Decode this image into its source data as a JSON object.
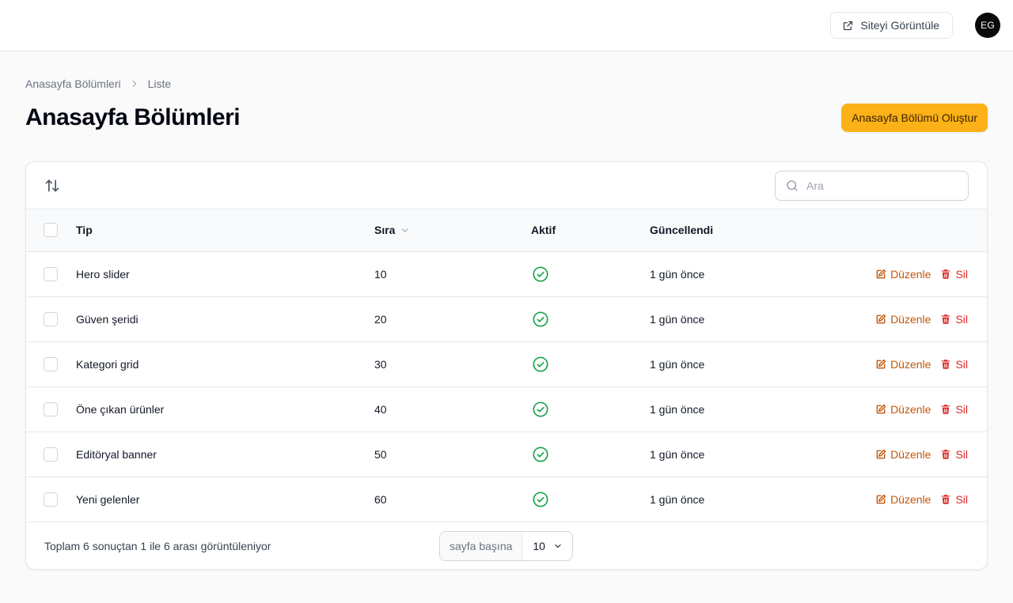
{
  "header": {
    "view_site_label": "Siteyi Görüntüle",
    "avatar_initials": "EG"
  },
  "breadcrumb": [
    "Anasayfa Bölümleri",
    "Liste"
  ],
  "page": {
    "title": "Anasayfa Bölümleri",
    "create_label": "Anasayfa Bölümü Oluştur"
  },
  "search": {
    "placeholder": "Ara"
  },
  "table": {
    "columns": {
      "tip": "Tip",
      "sira": "Sıra",
      "aktif": "Aktif",
      "guncellendi": "Güncellendi"
    },
    "rows": [
      {
        "tip": "Hero slider",
        "sira": "10",
        "aktif": true,
        "guncellendi": "1 gün önce"
      },
      {
        "tip": "Güven şeridi",
        "sira": "20",
        "aktif": true,
        "guncellendi": "1 gün önce"
      },
      {
        "tip": "Kategori grid",
        "sira": "30",
        "aktif": true,
        "guncellendi": "1 gün önce"
      },
      {
        "tip": "Öne çıkan ürünler",
        "sira": "40",
        "aktif": true,
        "guncellendi": "1 gün önce"
      },
      {
        "tip": "Editöryal banner",
        "sira": "50",
        "aktif": true,
        "guncellendi": "1 gün önce"
      },
      {
        "tip": "Yeni gelenler",
        "sira": "60",
        "aktif": true,
        "guncellendi": "1 gün önce"
      }
    ],
    "edit_label": "Düzenle",
    "delete_label": "Sil"
  },
  "footer": {
    "summary": "Toplam 6 sonuçtan 1 ile 6 arası görüntüleniyor",
    "per_page_label": "sayfa başına",
    "per_page_value": "10"
  },
  "colors": {
    "primary": "#fbb117",
    "edit": "#c2570a",
    "delete": "#dc2626",
    "active": "#16a34a"
  }
}
